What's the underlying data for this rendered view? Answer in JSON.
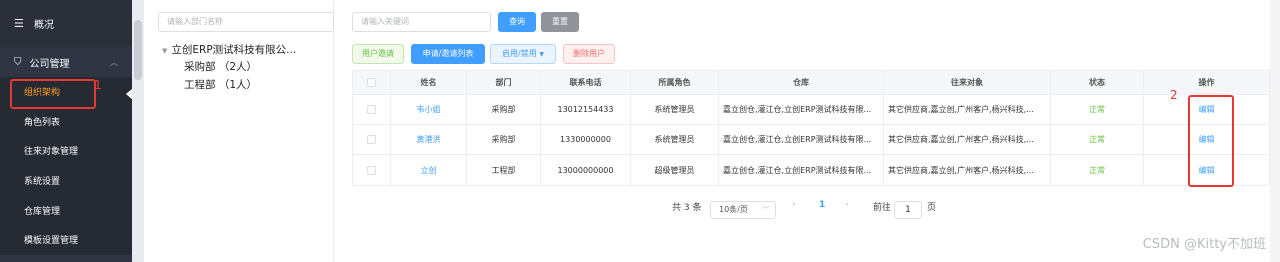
{
  "sidebar": {
    "overview": "概况",
    "group": "公司管理",
    "items": [
      {
        "label": "组织架构",
        "active": true
      },
      {
        "label": "角色列表"
      },
      {
        "label": "往来对象管理"
      },
      {
        "label": "系统设置"
      },
      {
        "label": "仓库管理"
      },
      {
        "label": "模板设置管理"
      }
    ]
  },
  "tree": {
    "search_placeholder": "请输入部门名称",
    "root": "立创ERP测试科技有限公...",
    "children": [
      "采购部 （2人）",
      "工程部 （1人）"
    ]
  },
  "toolbar": {
    "keyword_placeholder": "请输入关键词",
    "search_label": "查询",
    "reset_label": "重置",
    "invite_label": "用户邀请",
    "apply_list_label": "申请/邀请列表",
    "enable_label": "启用/禁用",
    "delete_label": "删除用户"
  },
  "table": {
    "headers": [
      "姓名",
      "部门",
      "联系电话",
      "所属角色",
      "仓库",
      "往来对象",
      "状态",
      "操作"
    ],
    "rows": [
      {
        "name": "韦小姐",
        "dept": "采购部",
        "phone": "13012154433",
        "role": "系统管理员",
        "warehouse": "嘉立创仓,灌江仓,立创ERP测试科技有限...",
        "partner": "其它供应商,嘉立创,广州客户,杨兴科技,...",
        "status": "正常",
        "op": "编辑"
      },
      {
        "name": "黄港洪",
        "dept": "采购部",
        "phone": "1330000000",
        "role": "系统管理员",
        "warehouse": "嘉立创仓,灌江仓,立创ERP测试科技有限...",
        "partner": "其它供应商,嘉立创,广州客户,杨兴科技,...",
        "status": "正常",
        "op": "编辑"
      },
      {
        "name": "立创",
        "dept": "工程部",
        "phone": "13000000000",
        "role": "超级管理员",
        "warehouse": "嘉立创仓,灌江仓,立创ERP测试科技有限...",
        "partner": "其它供应商,嘉立创,广州客户,杨兴科技,...",
        "status": "正常",
        "op": "编辑"
      }
    ]
  },
  "pagination": {
    "total": "共 3 条",
    "page_size": "10条/页",
    "current": "1",
    "goto_prefix": "前往",
    "goto_value": "1",
    "goto_suffix": "页"
  },
  "annotations": {
    "one": "1",
    "two": "2"
  },
  "watermark": "CSDN @Kitty不加班",
  "colors": {
    "accent": "#409eff",
    "active_menu": "#ff9f1c",
    "annotation": "#e53935",
    "sidebar": "#2f3542"
  }
}
